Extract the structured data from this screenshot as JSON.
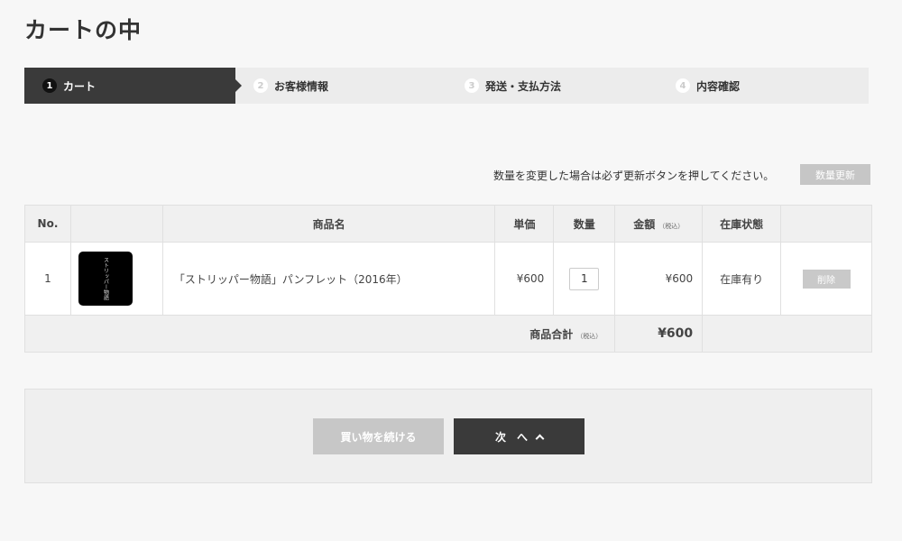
{
  "page": {
    "title": "カートの中"
  },
  "steps": [
    {
      "num": "1",
      "label": "カート",
      "active": true
    },
    {
      "num": "2",
      "label": "お客様情報",
      "active": false
    },
    {
      "num": "3",
      "label": "発送・支払方法",
      "active": false
    },
    {
      "num": "4",
      "label": "内容確認",
      "active": false
    }
  ],
  "notice": {
    "text": "数量を変更した場合は必ず更新ボタンを押してください。",
    "update_label": "数量更新"
  },
  "table": {
    "headers": {
      "no": "No.",
      "name": "商品名",
      "price": "単価",
      "qty": "数量",
      "amount": "金額",
      "tax_note": "（税込）",
      "stock": "在庫状態"
    },
    "rows": [
      {
        "no": "1",
        "thumb_text": "ストリッパー物語",
        "name": "「ストリッパー物語」パンフレット（2016年）",
        "price": "¥600",
        "qty": "1",
        "amount": "¥600",
        "stock": "在庫有り",
        "delete_label": "削除"
      }
    ],
    "total": {
      "label": "商品合計",
      "tax_note": "（税込）",
      "value": "¥600"
    }
  },
  "actions": {
    "continue_label": "買い物を続ける",
    "next_label": "次　へ"
  },
  "colors": {
    "accent_dark": "#3a3a3a",
    "total_red": "#f06a6a"
  }
}
